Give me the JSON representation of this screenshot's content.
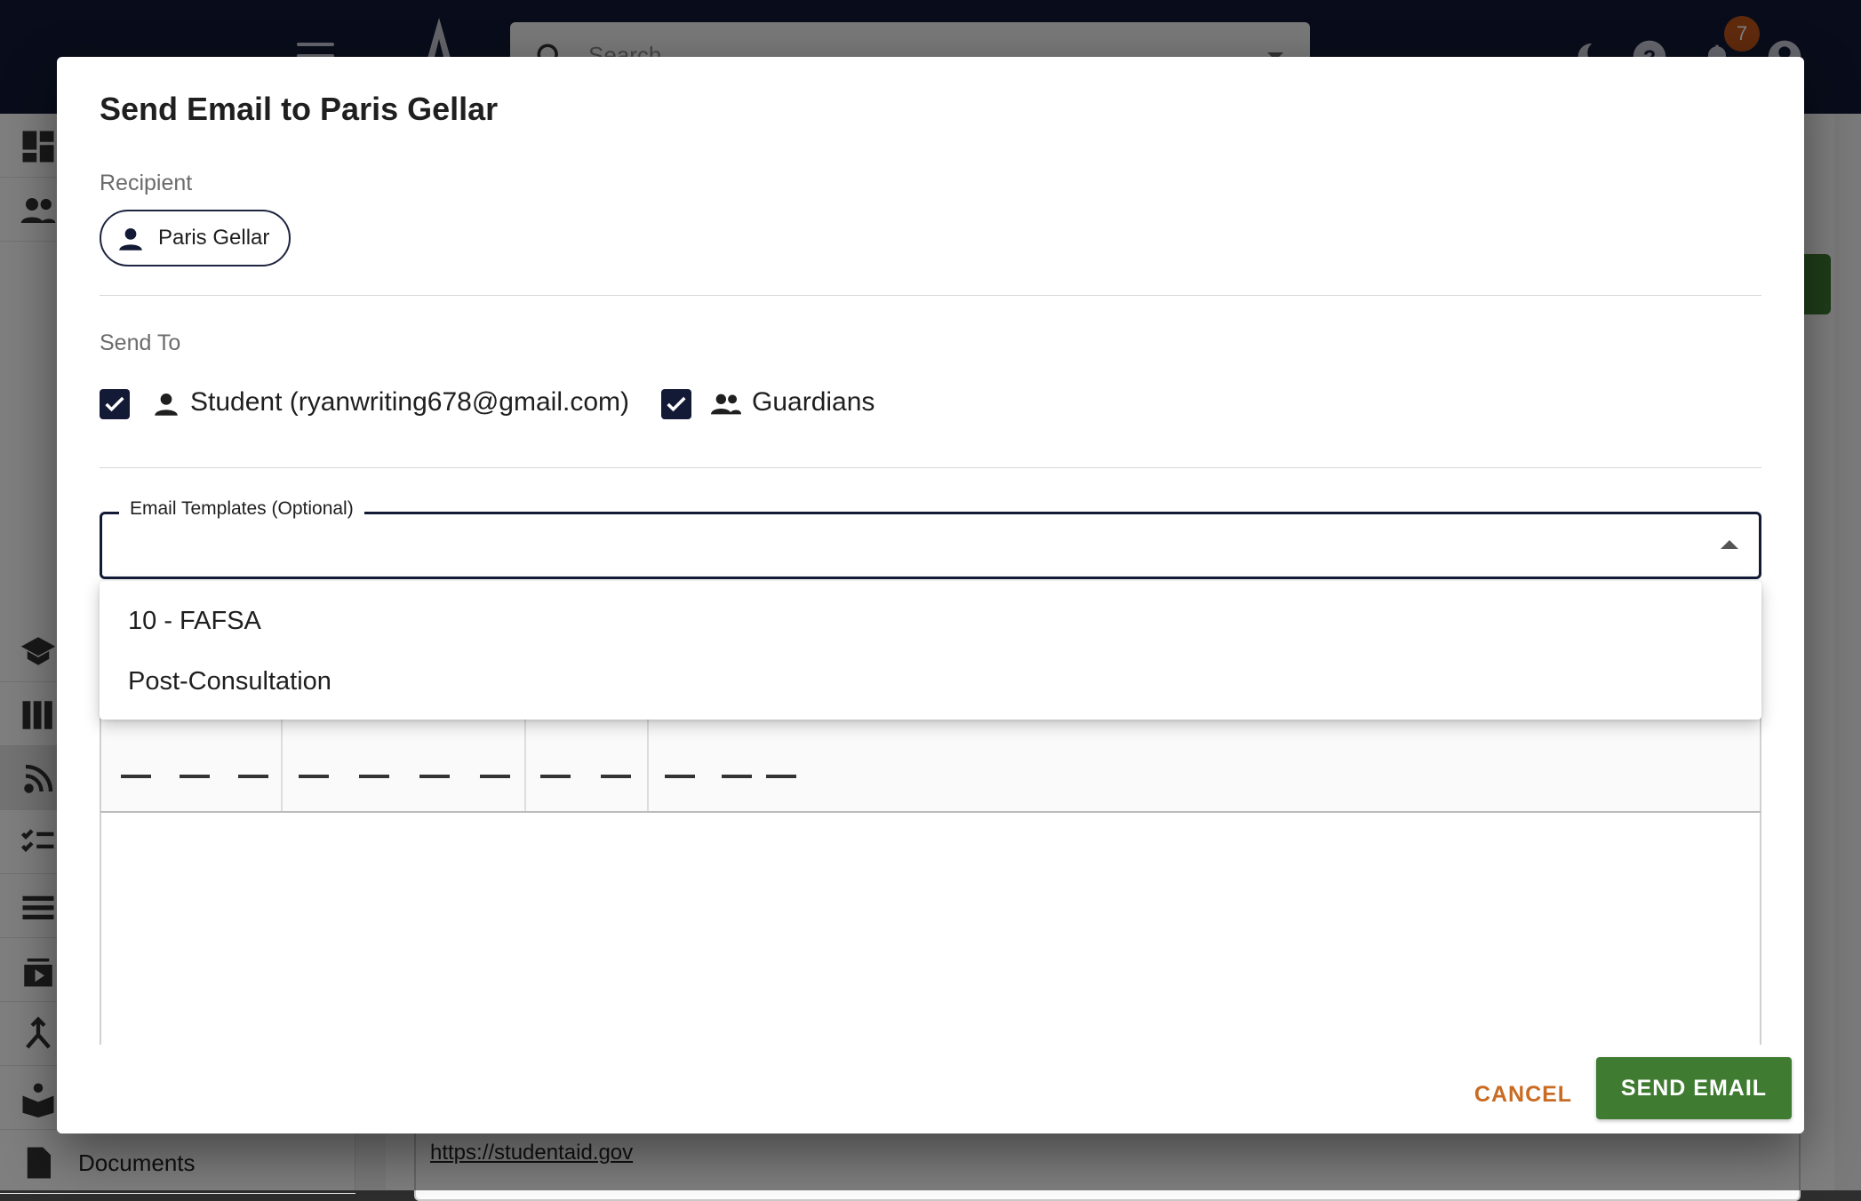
{
  "background": {
    "search_placeholder": "Search",
    "notification_count": "7",
    "sidebar_visible_label": "Documents",
    "link_text": "https://studentaid.gov"
  },
  "dialog": {
    "title": "Send Email to Paris Gellar",
    "recipient": {
      "label": "Recipient",
      "chip": "Paris Gellar"
    },
    "send_to": {
      "label": "Send To",
      "options": [
        {
          "label": "Student (ryanwriting678@gmail.com)",
          "checked": true,
          "icon": "person-icon"
        },
        {
          "label": "Guardians",
          "checked": true,
          "icon": "group-icon"
        }
      ]
    },
    "template_select": {
      "label": "Email Templates (Optional)",
      "value": "",
      "options": [
        "10 - FAFSA",
        "Post-Consultation"
      ]
    },
    "footer": {
      "cancel": "CANCEL",
      "send": "SEND EMAIL"
    }
  },
  "colors": {
    "navy": "#131a36",
    "accent_green": "#3f7c32",
    "cancel_orange": "#c96b22",
    "badge_orange": "#c0541a"
  }
}
